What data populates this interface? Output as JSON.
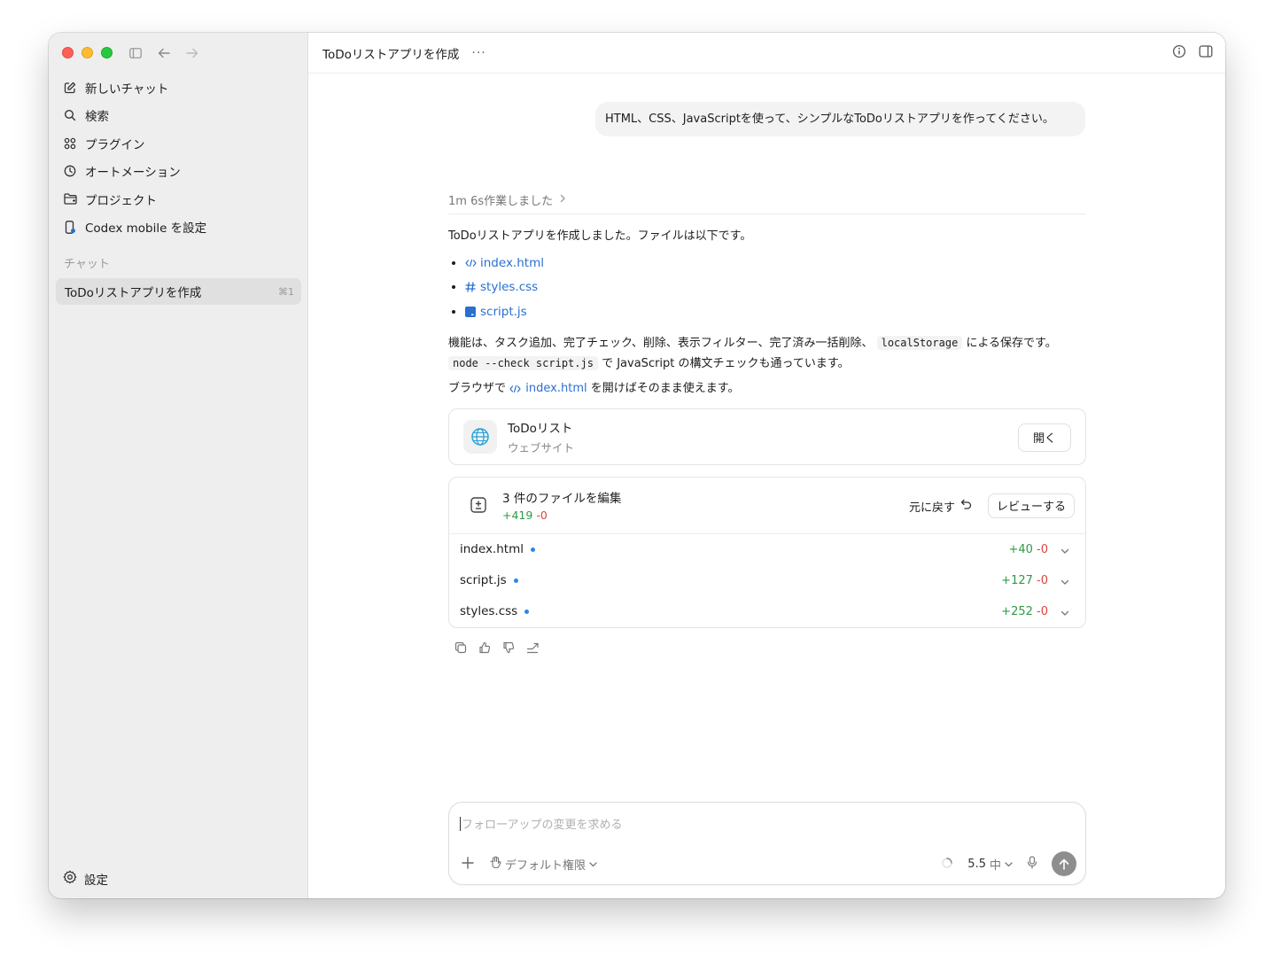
{
  "sidebar": {
    "nav": [
      {
        "label": "新しいチャット",
        "icon": "new-chat-icon"
      },
      {
        "label": "検索",
        "icon": "search-icon"
      },
      {
        "label": "プラグイン",
        "icon": "plugins-icon"
      },
      {
        "label": "オートメーション",
        "icon": "clock-icon"
      },
      {
        "label": "プロジェクト",
        "icon": "folder-icon"
      },
      {
        "label": "Codex mobile を設定",
        "icon": "phone-icon"
      }
    ],
    "section_label": "チャット",
    "chat": {
      "title": "ToDoリストアプリを作成",
      "shortcut": "⌘1"
    },
    "settings_label": "設定"
  },
  "header": {
    "title": "ToDoリストアプリを作成",
    "more": "···"
  },
  "user_message": "HTML、CSS、JavaScriptを使って、シンプルなToDoリストアプリを作ってください。",
  "assistant": {
    "worked": "1m 6s作業しました",
    "intro": "ToDoリストアプリを作成しました。ファイルは以下です。",
    "files": [
      {
        "name": "index.html",
        "icon": "html-icon"
      },
      {
        "name": "styles.css",
        "icon": "hash-icon"
      },
      {
        "name": "script.js",
        "icon": "js-icon"
      }
    ],
    "features_a": "機能は、タスク追加、完了チェック、削除、表示フィルター、完了済み一括削除、",
    "features_code": "localStorage",
    "features_b": "による保存です。",
    "check_code": "node --check script.js",
    "check_text": "で JavaScript の構文チェックも通っています。",
    "open_a": "ブラウザで",
    "open_link": "index.html",
    "open_b": "を開けばそのまま使えます。",
    "preview": {
      "title": "ToDoリスト",
      "subtitle": "ウェブサイト",
      "button": "開く"
    },
    "edits": {
      "title": "3 件のファイルを編集",
      "plus": "+419",
      "minus": "-0",
      "undo": "元に戻す",
      "review": "レビューする",
      "rows": [
        {
          "name": "index.html",
          "plus": "+40",
          "minus": "-0"
        },
        {
          "name": "script.js",
          "plus": "+127",
          "minus": "-0"
        },
        {
          "name": "styles.css",
          "plus": "+252",
          "minus": "-0"
        }
      ]
    }
  },
  "composer": {
    "placeholder": "フォローアップの変更を求める",
    "permission": "デフォルト権限",
    "model": "5.5",
    "effort": "中"
  },
  "colors": {
    "accent_link": "#2a6fd1",
    "diff_add": "#2f9a45",
    "diff_remove": "#d9463b",
    "unread_dot": "#2a86e8"
  }
}
